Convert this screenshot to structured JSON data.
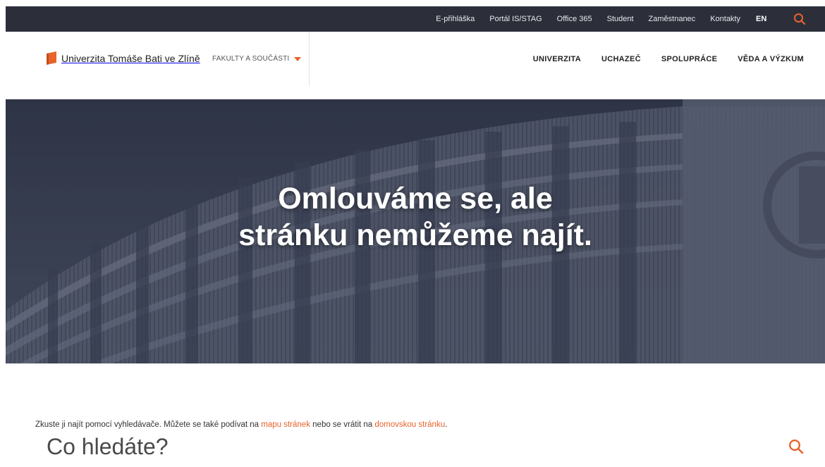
{
  "topbar": {
    "links": [
      "E-přihláška",
      "Portál IS/STAG",
      "Office 365",
      "Student",
      "Zaměstnanec",
      "Kontakty"
    ],
    "lang": "EN"
  },
  "header": {
    "logo_text": "Univerzita Tomáše Bati ve Zlíně",
    "faculties_label": "FAKULTY A SOUČÁSTI",
    "nav": [
      "UNIVERZITA",
      "UCHAZEČ",
      "SPOLUPRÁCE",
      "VĚDA A VÝZKUM"
    ]
  },
  "hero": {
    "title_line1": "Omlouváme se, ale",
    "title_line2": "stránku nemůžeme najít."
  },
  "intro": {
    "before": "Zkuste ji najít pomocí vyhledávače. Můžete se také podívat na ",
    "link1": "mapu stránek",
    "middle": " nebo se vrátit na ",
    "link2": "domovskou stránku",
    "after": "."
  },
  "search": {
    "placeholder": "Co hledáte?"
  },
  "colors": {
    "accent": "#e8622c",
    "topbar_bg": "#2c2f3a"
  },
  "icons": {
    "top_search": "search-icon",
    "logo": "book-logo-icon",
    "search_submit": "search-icon"
  }
}
